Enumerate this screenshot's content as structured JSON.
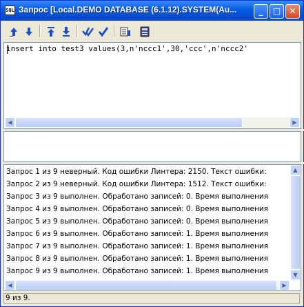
{
  "window": {
    "title": "Запрос [Local.DEMO DATABASE (6.1.12).SYSTEM(Au...",
    "app_icon_text": "SQL",
    "minimize": "_",
    "maximize": "□",
    "close": "✕"
  },
  "toolbar": {
    "buttons": [
      {
        "icon": "arrow-up-icon"
      },
      {
        "icon": "arrow-down-icon"
      },
      {
        "icon": "arrow-up-first-icon"
      },
      {
        "icon": "arrow-down-last-icon"
      },
      {
        "icon": "execute-check-icon"
      },
      {
        "icon": "check-icon"
      },
      {
        "icon": "explain-plan-icon"
      },
      {
        "icon": "database-icon"
      }
    ]
  },
  "editor": {
    "text": "insert into test3 values(3,n'nccc1',30,'ccc',n'nccc2'"
  },
  "log": {
    "lines": [
      "Запрос 1 из 9 неверный. Код ошибки Линтера: 2150. Текст ошибки:",
      "Запрос 2 из 9 неверный. Код ошибки Линтера: 1512. Текст ошибки:",
      "Запрос 3 из 9 выполнен. Обработано записей: 0. Время выполнения",
      "Запрос 4 из 9 выполнен. Обработано записей: 0. Время выполнения",
      "Запрос 5 из 9 выполнен. Обработано записей: 0. Время выполнения",
      "Запрос 6 из 9 выполнен. Обработано записей: 1. Время выполнения",
      "Запрос 7 из 9 выполнен. Обработано записей: 1. Время выполнения",
      "Запрос 8 из 9 выполнен. Обработано записей: 1. Время выполнения",
      "Запрос 9 из 9 выполнен. Обработано записей: 1. Время выполнения"
    ]
  },
  "status": {
    "text": "9 из 9."
  },
  "colors": {
    "title_bar": "#0a5fe0",
    "window_face": "#ece9d8",
    "icon_blue": "#1e4fc2"
  }
}
